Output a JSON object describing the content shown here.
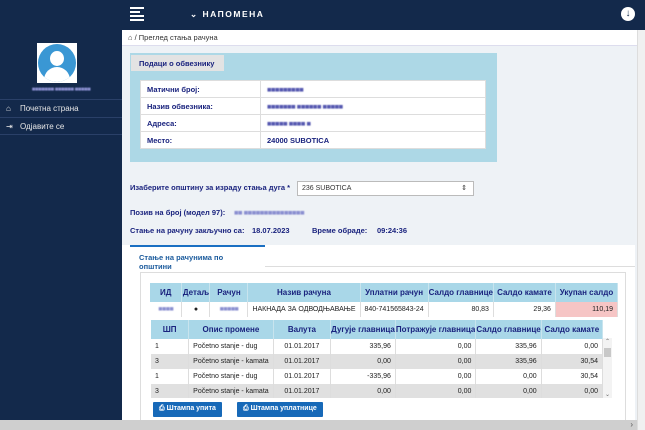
{
  "topbar": {
    "title": "НАПОМЕНА",
    "chevron": "⌄",
    "menu_icon": "hamburger-icon",
    "download_icon": "download-circle-icon"
  },
  "sidebar": {
    "user_name": "■■■■■■■ ■■■■■■ ■■■■■",
    "items": [
      {
        "label": "Почетна страна",
        "icon": "home-icon"
      },
      {
        "label": "Одјавите се",
        "icon": "sign-out-icon"
      }
    ]
  },
  "breadcrumb": {
    "text": "/ Преглед стања рачуна"
  },
  "taxpayer": {
    "title": "Подаци о обвезнику",
    "rows": [
      {
        "label": "Матични број:",
        "value": "■■■■■■■■■"
      },
      {
        "label": "Назив обвезника:",
        "value": "■■■■■■■ ■■■■■■ ■■■■■"
      },
      {
        "label": "Адреса:",
        "value": "■■■■■ ■■■■ ■"
      },
      {
        "label": "Место:",
        "value": "24000 SUBOTICA"
      }
    ]
  },
  "form": {
    "municipality_label": "Изаберите општину за израду стања дуга *",
    "municipality_value": "236 SUBOTICA",
    "reference_label": "Позив на број (модел 97):",
    "reference_value": "■■ ■■■■■■■■■■■■■■■",
    "closed_label": "Стање на рачуну закључно са:",
    "closed_date": "18.07.2023",
    "time_label": "Време обраде:",
    "time_value": "09:24:36"
  },
  "tab": {
    "label": "Стање на рачунима по општини"
  },
  "accounts": {
    "headers": [
      "ИД",
      "Детаљ",
      "Рачун",
      "Назив рачуна",
      "Уплатни рачун",
      "Салдо главнице",
      "Салдо камате",
      "Укупан салдо"
    ],
    "rows": [
      {
        "id": "■■■■",
        "account": "■■■■■",
        "name": "НАКНАДА ЗА ОДВОДЊАВАЊЕ",
        "payment_account": "840-741565843-24",
        "principal": "80,83",
        "interest": "29,36",
        "total": "110,19"
      }
    ]
  },
  "details": {
    "headers": [
      "ШП",
      "Опис промене",
      "Валута",
      "Дугује главница",
      "Потражује главница",
      "Салдо главнице",
      "Салдо камате"
    ],
    "rows": [
      [
        "1",
        "Početno stanje - dug",
        "01.01.2017",
        "335,96",
        "0,00",
        "335,96",
        "0,00"
      ],
      [
        "3",
        "Početno stanje - kamata",
        "01.01.2017",
        "0,00",
        "0,00",
        "335,96",
        "30,54"
      ],
      [
        "1",
        "Početno stanje - dug",
        "01.01.2017",
        "-335,96",
        "0,00",
        "0,00",
        "30,54"
      ],
      [
        "3",
        "Početno stanje - kamata",
        "01.01.2017",
        "0,00",
        "0,00",
        "0,00",
        "0,00"
      ]
    ]
  },
  "buttons": {
    "print_inquiry": "Штампа упита",
    "print_slip": "Штампа уплатнице"
  },
  "colors": {
    "navy": "#13294b",
    "panel": "#add8e6",
    "accent": "#1769b8",
    "highlight": "#f6c5c5"
  }
}
